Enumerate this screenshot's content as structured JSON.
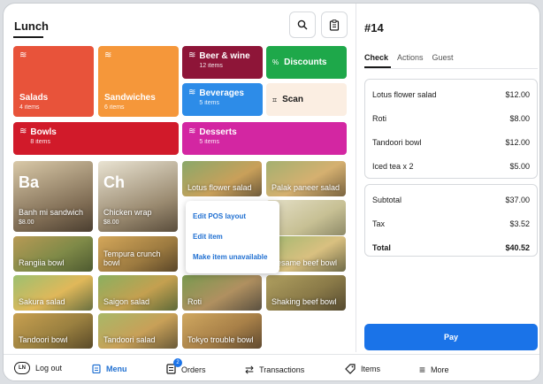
{
  "header": {
    "title": "Lunch",
    "search_icon": "search-icon",
    "clipboard_icon": "clipboard-icon"
  },
  "categories": [
    {
      "label": "Salads",
      "sub": "4 items",
      "color": "#e8533a"
    },
    {
      "label": "Sandwiches",
      "sub": "6 items",
      "color": "#f5973a"
    },
    {
      "label": "Beer & wine",
      "sub": "12 items",
      "color": "#8e1538"
    },
    {
      "label": "Discounts",
      "color": "#1ea84a"
    },
    {
      "label": "Beverages",
      "sub": "5 items",
      "color": "#2d8ce8"
    },
    {
      "label": "Scan",
      "color": "#fbeee2"
    },
    {
      "label": "Bowls",
      "sub": "8 items",
      "color": "#d11a2a"
    },
    {
      "label": "Desserts",
      "sub": "5 items",
      "color": "#d326a2"
    }
  ],
  "products": [
    {
      "abbr": "Ba",
      "name": "Banh mi sandwich",
      "price": "$8.00"
    },
    {
      "abbr": "Ch",
      "name": "Chicken wrap",
      "price": "$8.00"
    },
    {
      "name": "Lotus flower salad"
    },
    {
      "name": "Palak paneer salad"
    },
    {
      "name": "Rangiia bowl"
    },
    {
      "name": "Tempura crunch bowl"
    },
    {
      "name": "Sesame beef bowl"
    },
    {
      "name": "Sakura salad"
    },
    {
      "name": "Saigon salad"
    },
    {
      "name": "Roti"
    },
    {
      "name": "Shaking beef bowl"
    },
    {
      "name": "Tandoori bowl"
    },
    {
      "name": "Tandoori salad"
    },
    {
      "name": "Tokyo trouble bowl"
    }
  ],
  "context_menu": [
    "Edit POS layout",
    "Edit item",
    "Make item unavailable"
  ],
  "order": {
    "number": "#14",
    "tabs": [
      "Check",
      "Actions",
      "Guest"
    ],
    "lines": [
      {
        "name": "Lotus flower salad",
        "price": "$12.00"
      },
      {
        "name": "Roti",
        "price": "$8.00"
      },
      {
        "name": "Tandoori bowl",
        "price": "$12.00"
      },
      {
        "name": "Iced tea x 2",
        "price": "$5.00"
      }
    ],
    "subtotal_label": "Subtotal",
    "subtotal": "$37.00",
    "tax_label": "Tax",
    "tax": "$3.52",
    "total_label": "Total",
    "total": "$40.52",
    "pay_label": "Pay"
  },
  "bottom_nav": {
    "logout_badge": "LN",
    "logout": "Log out",
    "menu": "Menu",
    "orders": "Orders",
    "orders_count": "2",
    "transactions": "Transactions",
    "items": "Items",
    "more": "More"
  }
}
